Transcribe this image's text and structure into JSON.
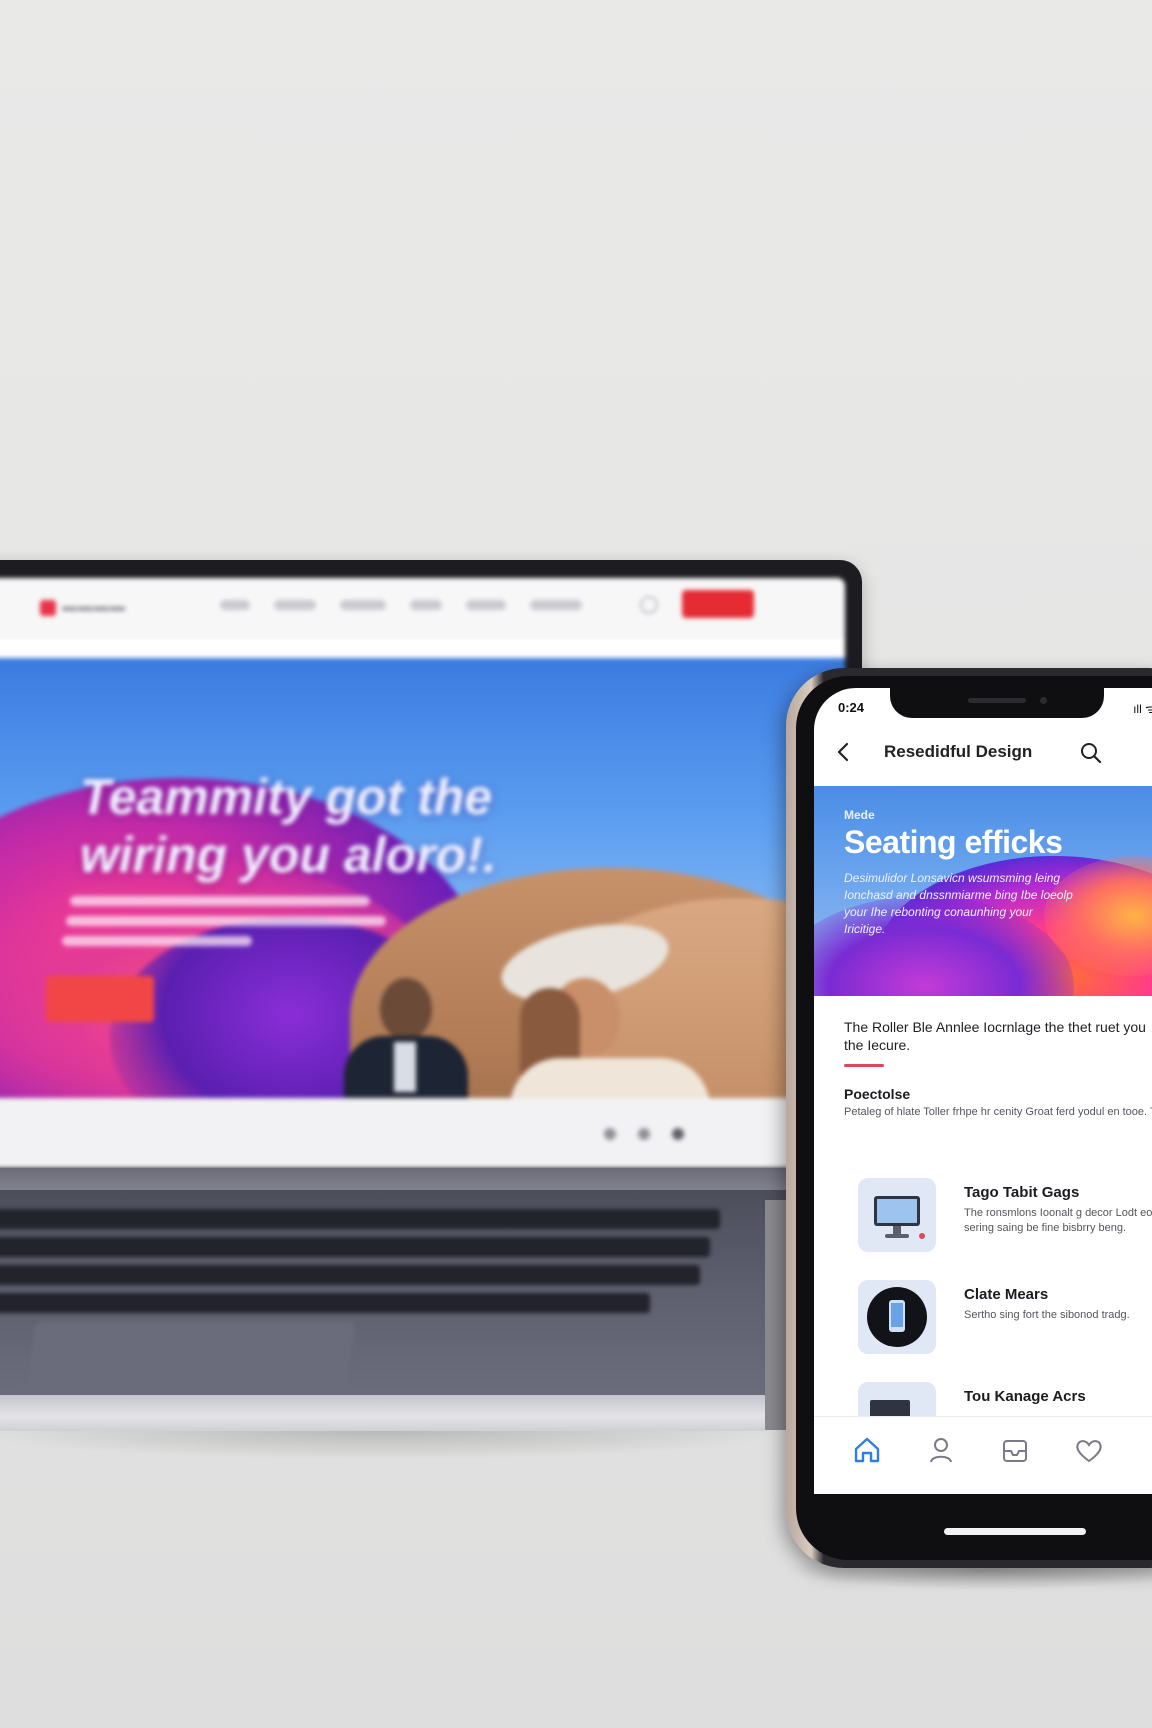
{
  "laptop": {
    "site": {
      "nav_cta_label": "",
      "hero_title": "Teammity got the wiring you aloro!.",
      "hero_cta_label": ""
    }
  },
  "phone": {
    "status": {
      "time": "0:24",
      "signal": "ıll ᯤ ▮"
    },
    "header": {
      "back_icon": "chevron-left-icon",
      "title": "Resedidful Design",
      "search_icon": "search-icon"
    },
    "banner": {
      "tag": "Mede",
      "title": "Seating efficks",
      "description": "Desimulidor Lonsavicn wsumsming leing Ionchasd and dnssnmiarme bing Ibe loeolp your Ihe rebonting conaunhing your Iricitige."
    },
    "intro": {
      "text": "The Roller Ble Annlee Iocrnlage the thet ruet you the Iecure."
    },
    "section": {
      "title": "Poectolse",
      "text": "Petaleg of hlate Toller frhpe hr cenity Groat ferd yodul en tooe. Tora ofthe goit."
    },
    "list": [
      {
        "title": "Tago Tabit Gags",
        "description": "The ronsmlons Ioonalt g decor Lodt eoritic sering saing be fine bisbrry beng.",
        "icon": "monitor-icon"
      },
      {
        "title": "Clate Mears",
        "description": "Sertho sing fort the sibonod tradg.",
        "icon": "phone-icon"
      },
      {
        "title": "Tou Kanage Acrs",
        "description": "",
        "icon": "image-icon"
      }
    ],
    "tabbar": [
      {
        "icon": "home-icon",
        "active": true
      },
      {
        "icon": "user-icon",
        "active": false
      },
      {
        "icon": "inbox-icon",
        "active": false
      },
      {
        "icon": "heart-icon",
        "active": false
      }
    ]
  },
  "colors": {
    "accent": "#e52c35",
    "tab_active": "#2f7ee6",
    "tab_inactive": "#7a7a86"
  }
}
